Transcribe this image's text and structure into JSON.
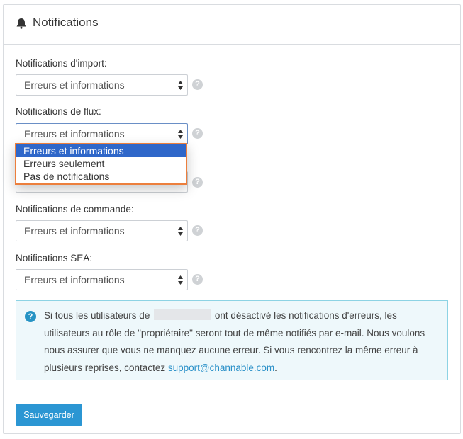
{
  "header": {
    "title": "Notifications",
    "icon": "bell-icon"
  },
  "fields": [
    {
      "label": "Notifications d'import:",
      "value": "Erreurs et informations"
    },
    {
      "label": "Notifications de flux:",
      "value": "Erreurs et informations"
    },
    {
      "label": "",
      "value": ""
    },
    {
      "label": "Notifications de commande:",
      "value": "Erreurs et informations"
    },
    {
      "label": "Notifications SEA:",
      "value": "Erreurs et informations"
    }
  ],
  "help_glyph": "?",
  "dropdown": {
    "options": [
      "Erreurs et informations",
      "Erreurs seulement",
      "Pas de notifications"
    ],
    "selected_index": 0
  },
  "info": {
    "icon_glyph": "?",
    "text_before": "Si tous les utilisateurs de",
    "text_after": "ont désactivé les notifications d'erreurs, les utilisateurs au rôle de \"propriétaire\" seront tout de même notifiés par e-mail. Nous voulons nous assurer que vous ne manquez aucune erreur. Si vous rencontrez la même erreur à plusieurs reprises, contactez",
    "link": "support@channable.com",
    "end": "."
  },
  "footer": {
    "save_label": "Sauvegarder"
  },
  "colors": {
    "primary": "#2b96d3",
    "highlight": "#2f67c9",
    "annotation": "#ec7f3d",
    "info_bg": "#eef8fb"
  }
}
